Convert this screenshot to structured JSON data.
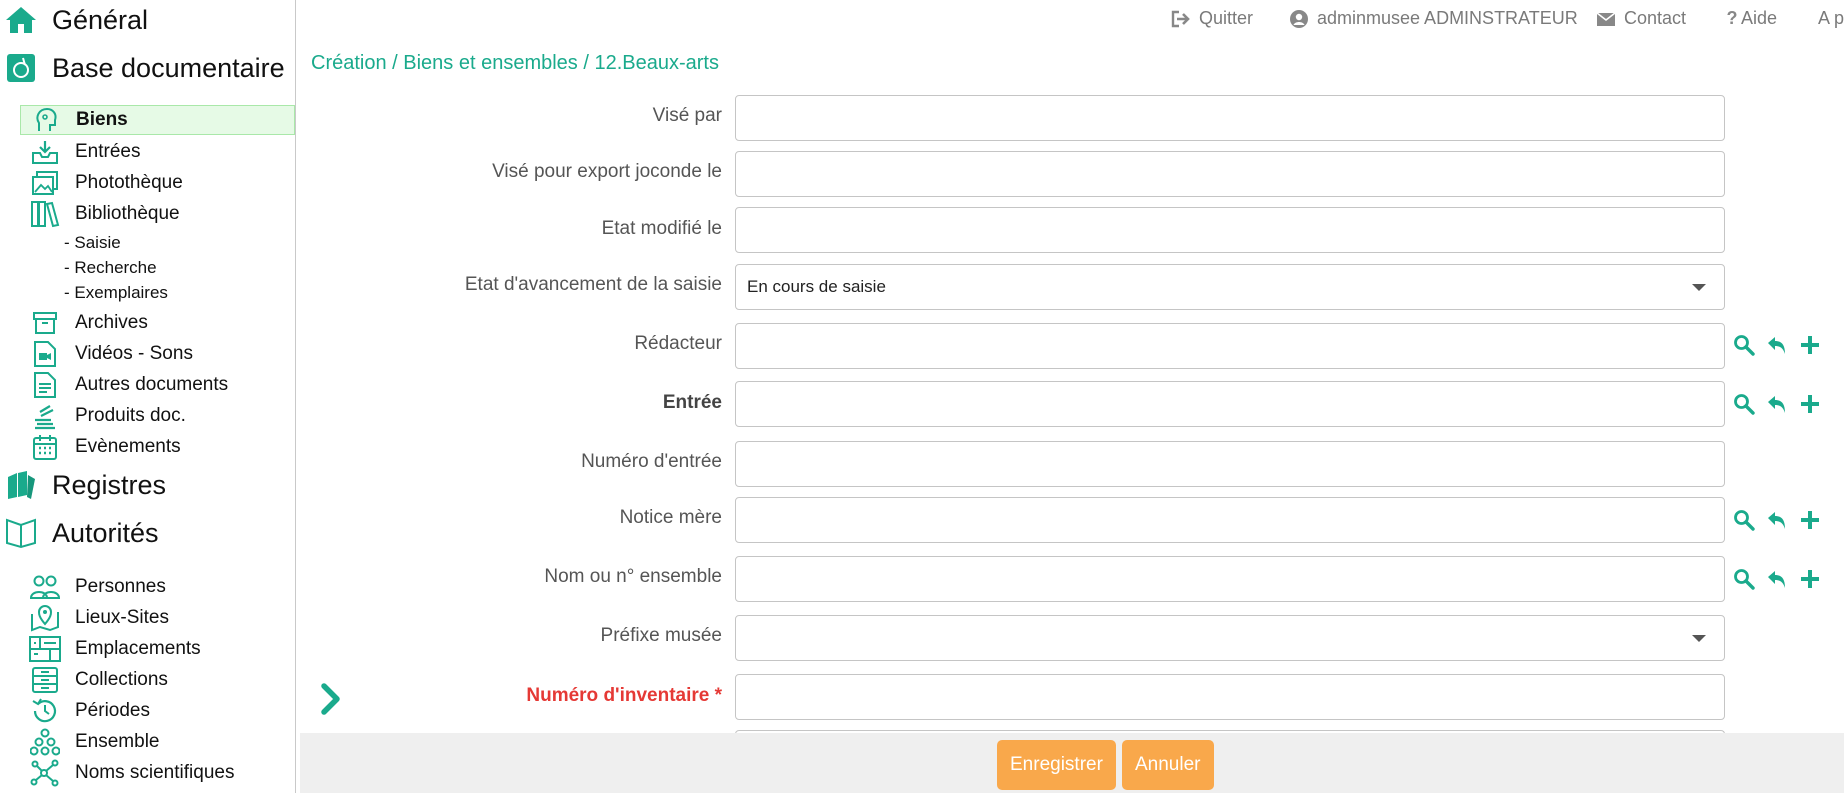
{
  "colors": {
    "accent": "#1aaa8c",
    "active_bg": "#e6fae6",
    "required": "#e53935",
    "button": "#f9a84b",
    "bottom_bar": "#efefef"
  },
  "sidebar": {
    "sections": [
      {
        "label": "Général",
        "icon": "home-icon"
      },
      {
        "label": "Base documentaire",
        "icon": "documents-icon"
      },
      {
        "label": "Registres",
        "icon": "books-icon"
      },
      {
        "label": "Autorités",
        "icon": "open-book-icon"
      }
    ],
    "base_items": [
      {
        "label": "Biens",
        "icon": "object-icon",
        "active": true
      },
      {
        "label": "Entrées",
        "icon": "inbox-icon"
      },
      {
        "label": "Photothèque",
        "icon": "images-icon"
      },
      {
        "label": "Bibliothèque",
        "icon": "library-icon"
      }
    ],
    "bibliotheque_sub": [
      "- Saisie",
      "- Recherche",
      "- Exemplaires"
    ],
    "base_items_2": [
      {
        "label": "Archives",
        "icon": "archive-icon"
      },
      {
        "label": "Vidéos - Sons",
        "icon": "video-file-icon"
      },
      {
        "label": "Autres documents",
        "icon": "document-icon"
      },
      {
        "label": "Produits doc.",
        "icon": "stack-icon"
      },
      {
        "label": "Evènements",
        "icon": "calendar-icon"
      }
    ],
    "autorites_items": [
      {
        "label": "Personnes",
        "icon": "people-icon"
      },
      {
        "label": "Lieux-Sites",
        "icon": "map-pin-icon"
      },
      {
        "label": "Emplacements",
        "icon": "storage-icon"
      },
      {
        "label": "Collections",
        "icon": "drawers-icon"
      },
      {
        "label": "Périodes",
        "icon": "history-icon"
      },
      {
        "label": "Ensemble",
        "icon": "cluster-icon"
      },
      {
        "label": "Noms scientifiques",
        "icon": "molecule-icon"
      }
    ]
  },
  "topbar": {
    "quit": "Quitter",
    "user": "adminmusee ADMINSTRATEUR",
    "contact": "Contact",
    "help": "Aide",
    "truncated": "A p"
  },
  "breadcrumb": "Création / Biens et ensembles / 12.Beaux-arts",
  "form": {
    "fields": [
      {
        "label": "Visé par",
        "value": ""
      },
      {
        "label": "Visé pour export joconde le",
        "value": ""
      },
      {
        "label": "Etat modifié le",
        "value": ""
      },
      {
        "label": "Etat d'avancement de la saisie",
        "value": "En cours de saisie",
        "type": "select"
      },
      {
        "label": "Rédacteur",
        "value": "",
        "actions": true
      },
      {
        "label": "Entrée",
        "value": "",
        "actions": true,
        "bold": true
      },
      {
        "label": "Numéro d'entrée",
        "value": ""
      },
      {
        "label": "Notice mère",
        "value": "",
        "actions": true
      },
      {
        "label": "Nom ou n° ensemble",
        "value": "",
        "actions": true
      },
      {
        "label": "Préfixe musée",
        "value": "",
        "type": "select"
      },
      {
        "label": "Numéro d'inventaire *",
        "value": "",
        "required": true
      }
    ]
  },
  "buttons": {
    "save": "Enregistrer",
    "cancel": "Annuler"
  }
}
